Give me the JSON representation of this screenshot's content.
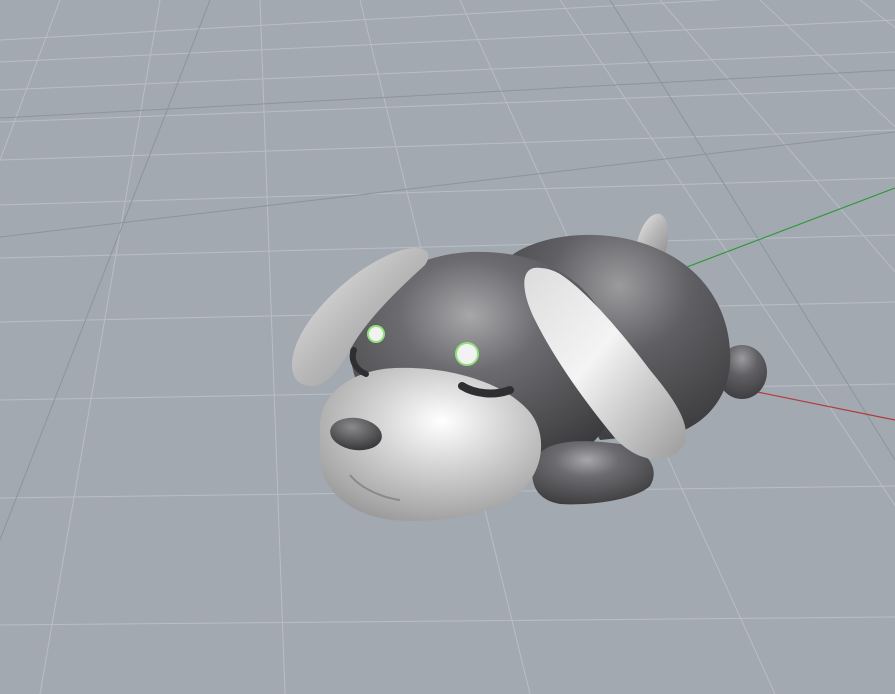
{
  "viewport": {
    "background": "#a3a9b1",
    "grid_color": "#b9bec5",
    "grid_major_color": "#8e949b",
    "x_axis_color": "#b03a3a",
    "y_axis_color": "#2f9a3a"
  },
  "model": {
    "body_dark": "#5e5e61",
    "body_light": "#d9d9d9",
    "selection_highlight": "#8fe27a"
  }
}
